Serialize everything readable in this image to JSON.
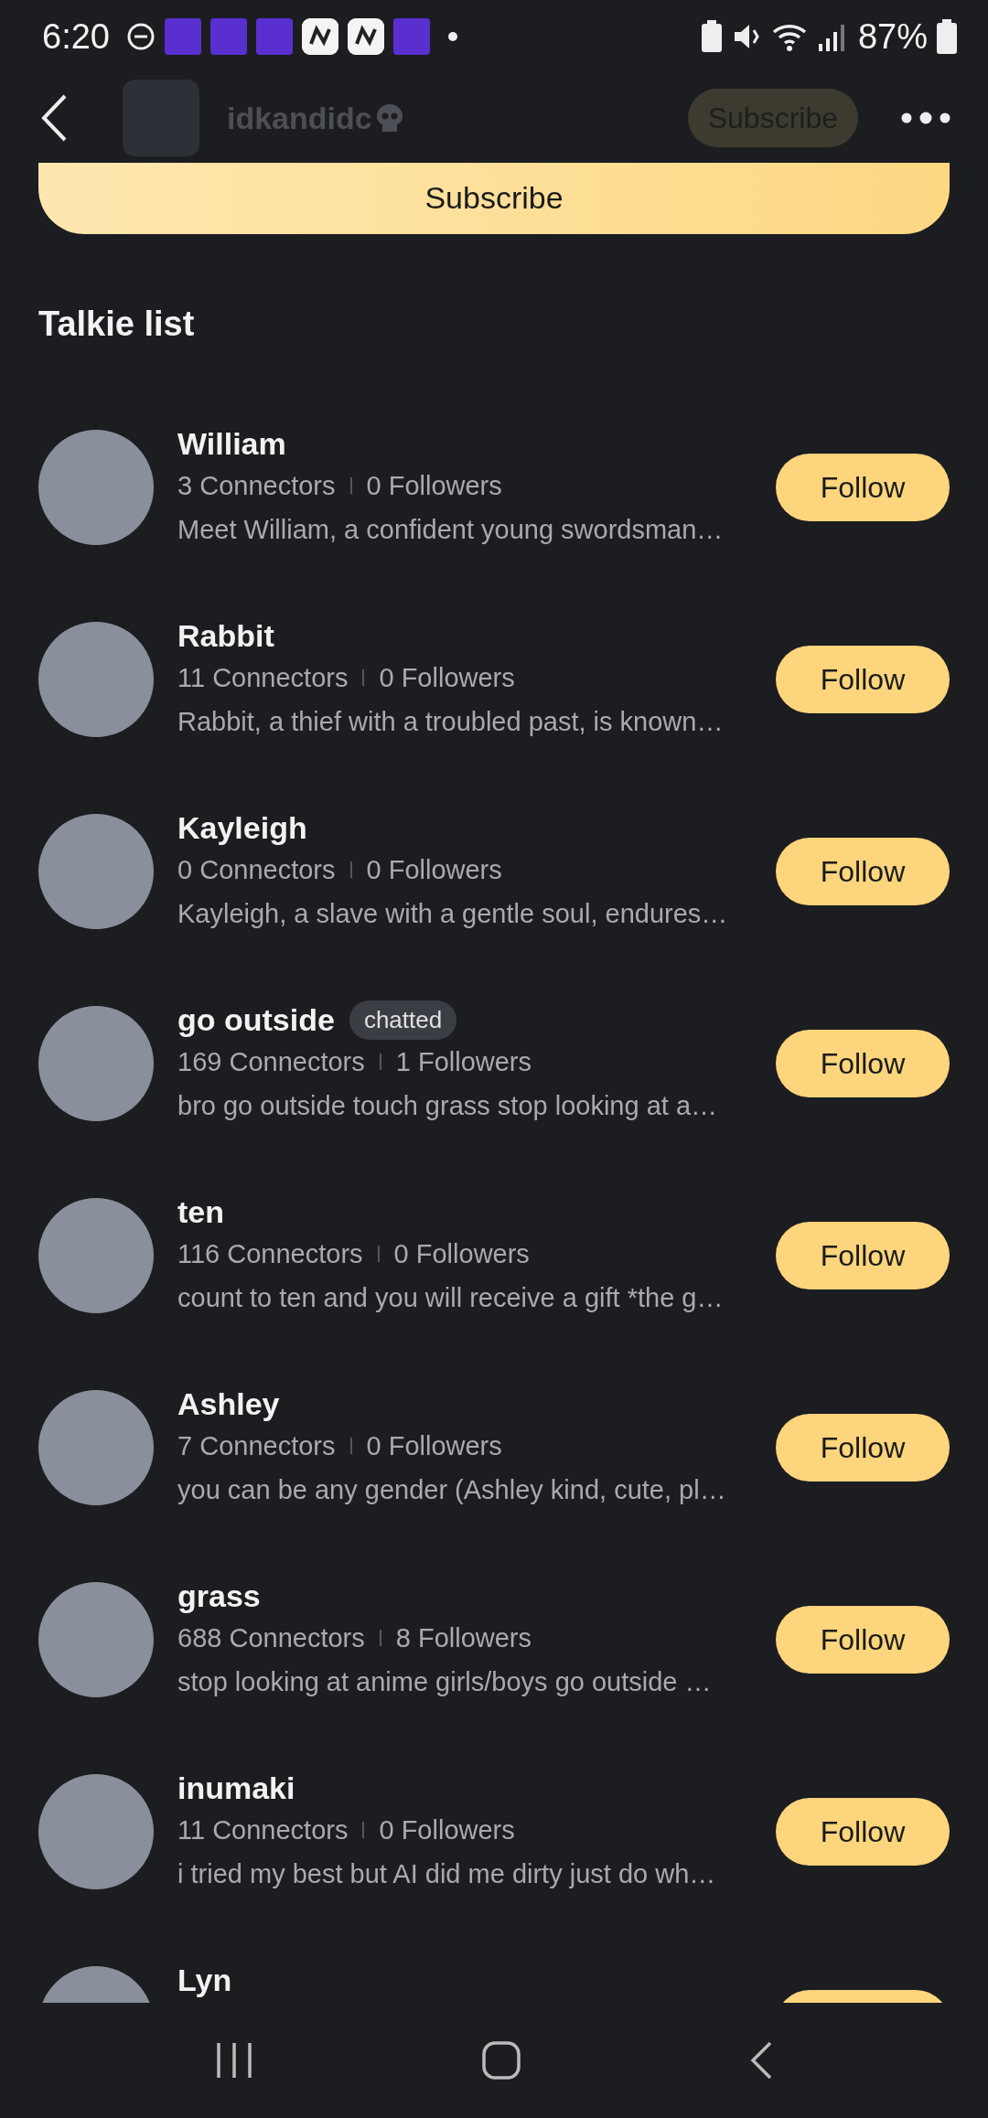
{
  "status_bar": {
    "time": "6:20",
    "battery": "87%"
  },
  "header": {
    "title": "idkandidc",
    "subscribe": "Subscribe"
  },
  "subscribe_button": "Subscribe",
  "section_title": "Talkie list",
  "talkies": [
    {
      "name": "William",
      "connectors": "3 Connectors",
      "followers": "0 Followers",
      "description": "Meet William, a confident young swordsman…",
      "follow": "Follow"
    },
    {
      "name": "Rabbit",
      "connectors": "11 Connectors",
      "followers": "0 Followers",
      "description": "Rabbit, a thief with a troubled past, is known…",
      "follow": "Follow"
    },
    {
      "name": "Kayleigh",
      "connectors": "0 Connectors",
      "followers": "0 Followers",
      "description": "Kayleigh, a slave with a gentle soul, endures…",
      "follow": "Follow"
    },
    {
      "name": "go outside",
      "badge": "chatted",
      "connectors": "169 Connectors",
      "followers": "1 Followers",
      "description": "bro go outside touch grass stop looking at a…",
      "follow": "Follow"
    },
    {
      "name": "ten",
      "connectors": "116 Connectors",
      "followers": "0 Followers",
      "description": "count to ten and you will receive a gift *the g…",
      "follow": "Follow"
    },
    {
      "name": "Ashley",
      "connectors": "7 Connectors",
      "followers": "0 Followers",
      "description": "you can be any gender (Ashley kind, cute, pl…",
      "follow": "Follow"
    },
    {
      "name": "grass",
      "connectors": "688 Connectors",
      "followers": "8 Followers",
      "description": "stop looking at anime girls/boys go outside …",
      "follow": "Follow"
    },
    {
      "name": "inumaki",
      "connectors": "11 Connectors",
      "followers": "0 Followers",
      "description": "i tried my best but AI did me dirty just do wh…",
      "follow": "Follow"
    },
    {
      "name": "Lyn"
    }
  ]
}
